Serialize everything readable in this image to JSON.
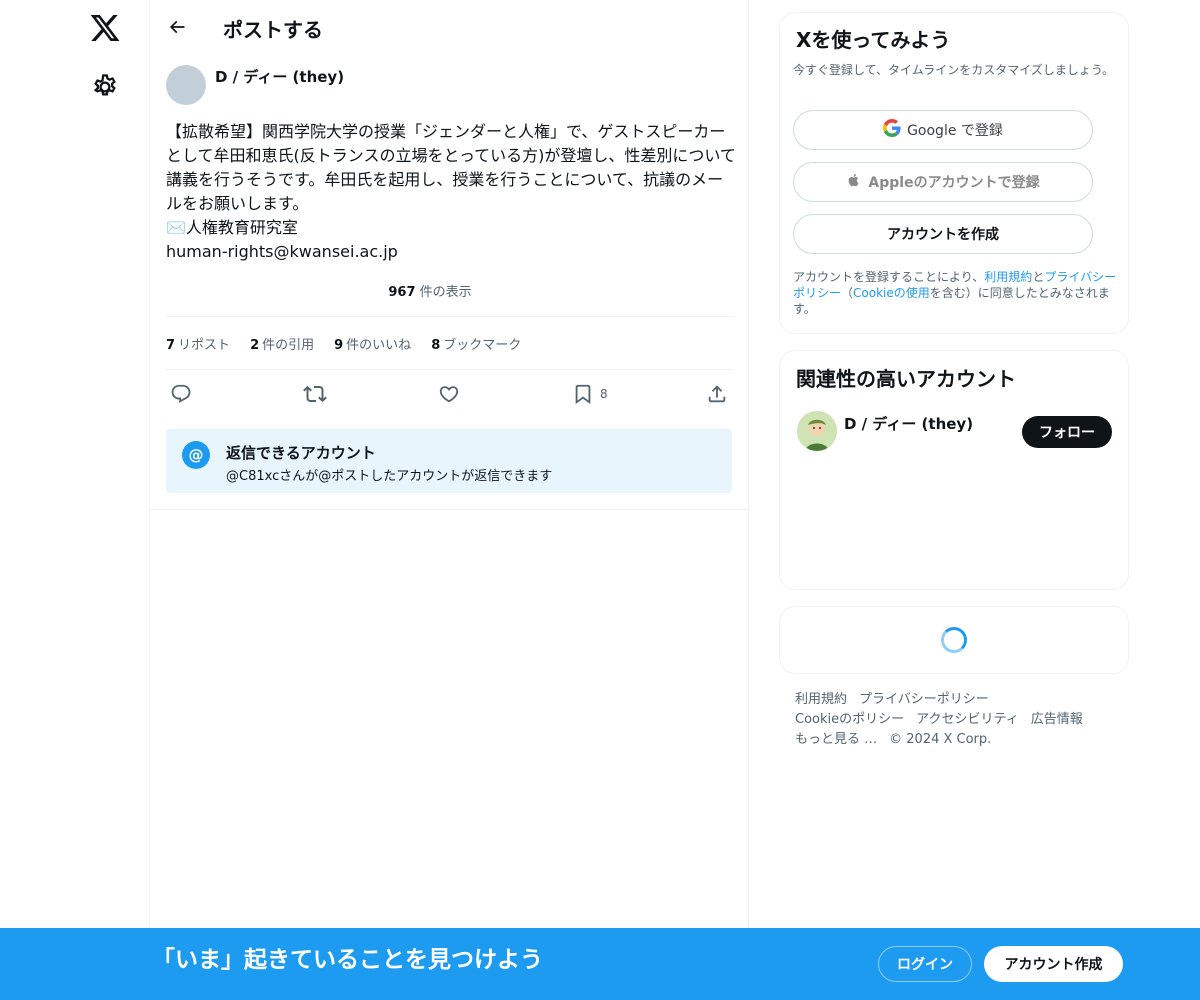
{
  "header": {
    "title": "ポストする"
  },
  "post": {
    "author": "D / ディー (they)",
    "text": "【拡散希望】関西学院大学の授業「ジェンダーと人権」で、ゲストスピーカーとして牟田和恵氏(反トランスの立場をとっている方)が登壇し、性差別について講義を行うそうです。牟田氏を起用し、授業を行うことについて、抗議のメールをお願いします。\n✉️人権教育研究室\nhuman-rights@kwansei.ac.jp",
    "views_count": "967",
    "views_label": " 件の表示",
    "stats": [
      {
        "count": "7",
        "label": "リポスト"
      },
      {
        "count": "2",
        "label": "件の引用"
      },
      {
        "count": "9",
        "label": "件のいいね"
      },
      {
        "count": "8",
        "label": "ブックマーク"
      }
    ],
    "bookmark_count": "8"
  },
  "reply_restriction": {
    "title": "返信できるアカウント",
    "subtitle": "@C81xcさんが@ポストしたアカウントが返信できます",
    "icon_label": "@"
  },
  "signup_card": {
    "title": "Xを使ってみよう",
    "subtitle": "今すぐ登録して、タイムラインをカスタマイズしましょう。",
    "google_label": "Google で登録",
    "apple_label": "Appleのアカウントで登録",
    "create_label": "アカウントを作成",
    "legal_1": "アカウントを登録することにより、",
    "legal_terms": "利用規約",
    "legal_2": "と",
    "legal_privacy": "プライバシーポリシー",
    "legal_3": "（",
    "legal_cookie": "Cookieの使用",
    "legal_4": "を含む）に同意したとみなされます。"
  },
  "relevant_card": {
    "title": "関連性の高いアカウント",
    "account_name": "D / ディー (they)",
    "follow_label": "フォロー"
  },
  "footer": {
    "terms": "利用規約",
    "privacy": "プライバシーポリシー",
    "cookie": "Cookieのポリシー",
    "accessibility": "アクセシビリティ",
    "ads": "広告情報",
    "more": "もっと見る …",
    "copyright": "© 2024 X Corp."
  },
  "banner": {
    "text": "「いま」起きていることを見つけよう",
    "login_label": "ログイン",
    "signup_label": "アカウント作成"
  },
  "colors": {
    "accent": "#1d9bf0",
    "text": "#0f1419",
    "muted": "#536471"
  }
}
